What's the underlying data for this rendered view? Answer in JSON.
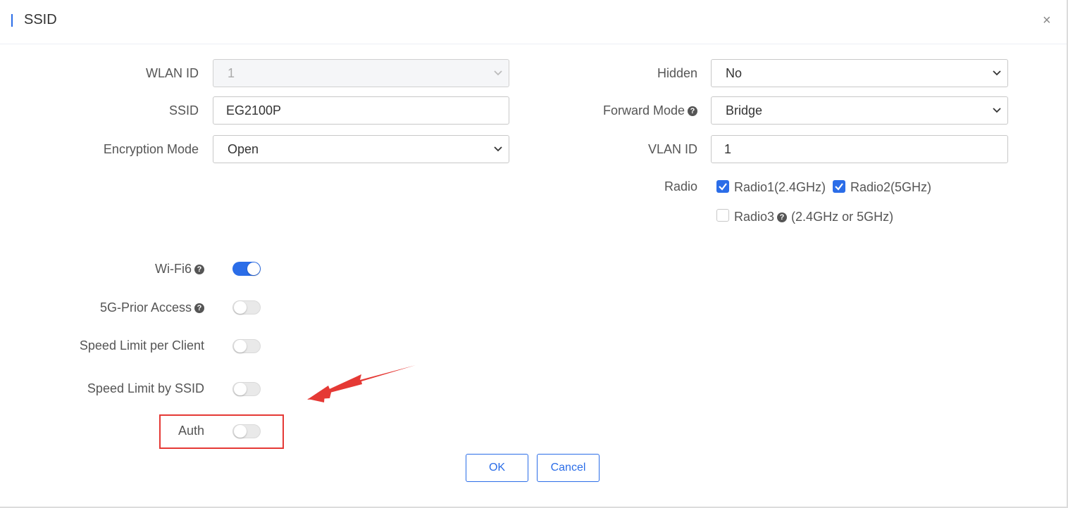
{
  "dialog": {
    "title": "SSID",
    "close_glyph": "×"
  },
  "left_fields": {
    "wlan_id": {
      "label": "WLAN ID",
      "value": "1"
    },
    "ssid": {
      "label": "SSID",
      "value": "EG2100P"
    },
    "encryption_mode": {
      "label": "Encryption Mode",
      "value": "Open"
    }
  },
  "right_fields": {
    "hidden": {
      "label": "Hidden",
      "value": "No"
    },
    "forward_mode": {
      "label": "Forward Mode",
      "value": "Bridge"
    },
    "vlan_id": {
      "label": "VLAN ID",
      "value": "1"
    },
    "radio": {
      "label": "Radio",
      "options": [
        {
          "label": "Radio1(2.4GHz)",
          "checked": true
        },
        {
          "label": "Radio2(5GHz)",
          "checked": true
        },
        {
          "label": "Radio3",
          "suffix": "(2.4GHz or 5GHz)",
          "checked": false
        }
      ]
    }
  },
  "toggles": {
    "wifi6": {
      "label": "Wi-Fi6",
      "on": true
    },
    "prior_5g": {
      "label": "5G-Prior Access",
      "on": false
    },
    "speed_client": {
      "label": "Speed Limit per Client",
      "on": false
    },
    "speed_ssid": {
      "label": "Speed Limit by SSID",
      "on": false
    },
    "auth": {
      "label": "Auth",
      "on": false
    }
  },
  "help_glyph": "?",
  "buttons": {
    "ok": "OK",
    "cancel": "Cancel"
  },
  "colors": {
    "accent": "#2b6de8",
    "annotation": "#e53935"
  }
}
